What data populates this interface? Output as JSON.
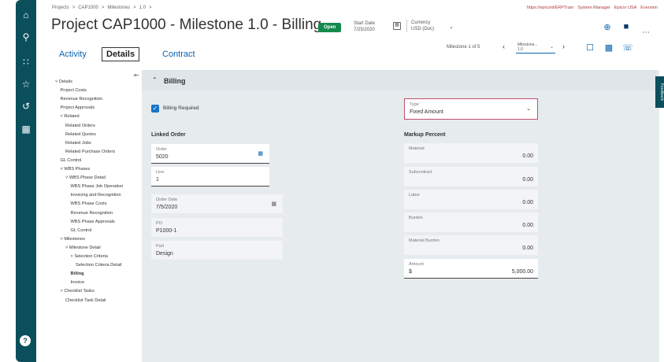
{
  "breadcrumb": [
    "Projects",
    ">",
    "CAP1000",
    ">",
    "Milestones",
    ">",
    "1.0",
    ">"
  ],
  "top_links": [
    "https://epicorti/ERPTrain",
    "System Manager",
    "Epicor USA",
    "Everston"
  ],
  "title": "Project CAP1000 - Milestone 1.0 - Billing",
  "status_badge": "Open",
  "start_date": {
    "label": "Start Date",
    "value": "7/25/2020"
  },
  "currency": {
    "label": "Currency",
    "value": "USD (Doc)"
  },
  "tabs": [
    {
      "label": "Activity"
    },
    {
      "label": "Details"
    },
    {
      "label": "Contract"
    }
  ],
  "milestone_nav": {
    "label": "Milestone 1 of 5",
    "select_label": "Milestone...",
    "select_value": "1.0"
  },
  "tree": [
    {
      "label": "˅ Details",
      "indent": 0,
      "bold": false
    },
    {
      "label": "Project Costs",
      "indent": 1,
      "bold": false
    },
    {
      "label": "Revenue Recognition",
      "indent": 1,
      "bold": false
    },
    {
      "label": "Project Approvals",
      "indent": 1,
      "bold": false
    },
    {
      "label": "˅ Related",
      "indent": 1,
      "bold": false
    },
    {
      "label": "Related Orders",
      "indent": 2,
      "bold": false
    },
    {
      "label": "Related Quotes",
      "indent": 2,
      "bold": false
    },
    {
      "label": "Related Jobs",
      "indent": 2,
      "bold": false
    },
    {
      "label": "Related Purchase Orders",
      "indent": 2,
      "bold": false
    },
    {
      "label": "GL Control",
      "indent": 1,
      "bold": false
    },
    {
      "label": "˅ WBS Phases",
      "indent": 1,
      "bold": false
    },
    {
      "label": "˅ WBS Phase Detail",
      "indent": 2,
      "bold": false
    },
    {
      "label": "WBS Phase Job Operation",
      "indent": 3,
      "bold": false
    },
    {
      "label": "Invoicing and Recognition",
      "indent": 3,
      "bold": false
    },
    {
      "label": "WBS Phase Costs",
      "indent": 3,
      "bold": false
    },
    {
      "label": "Revenue Recognition",
      "indent": 3,
      "bold": false
    },
    {
      "label": "WBS Phase Approvals",
      "indent": 3,
      "bold": false
    },
    {
      "label": "GL Control",
      "indent": 3,
      "bold": false
    },
    {
      "label": "˅ Milestones",
      "indent": 1,
      "bold": false
    },
    {
      "label": "˅ Milestone Detail",
      "indent": 2,
      "bold": false
    },
    {
      "label": "˅ Selection Criteria",
      "indent": 3,
      "bold": false
    },
    {
      "label": "Selection Criteria Detail",
      "indent": 4,
      "bold": false
    },
    {
      "label": "Billing",
      "indent": 3,
      "bold": true
    },
    {
      "label": "Invoice",
      "indent": 3,
      "bold": false
    },
    {
      "label": "˅ Checklist Tasks",
      "indent": 1,
      "bold": false
    },
    {
      "label": "Checklist Task Detail",
      "indent": 2,
      "bold": false
    }
  ],
  "section": {
    "title": "Billing"
  },
  "billing_required": {
    "label": "Billing Required",
    "checked": true
  },
  "type_field": {
    "label": "Type",
    "value": "Fixed Amount"
  },
  "linked_order": {
    "title": "Linked Order",
    "order": {
      "label": "Order",
      "value": "5020"
    },
    "line": {
      "label": "Line",
      "value": "1"
    },
    "order_date": {
      "label": "Order Date",
      "value": "7/5/2020"
    },
    "po": {
      "label": "PO",
      "value": "P1000-1"
    },
    "part": {
      "label": "Part",
      "value": "Design"
    }
  },
  "markup": {
    "title": "Markup Percent",
    "material": {
      "label": "Material",
      "value": "0.00"
    },
    "subcontract": {
      "label": "Subcontract",
      "value": "0.00"
    },
    "labor": {
      "label": "Labor",
      "value": "0.00"
    },
    "burden": {
      "label": "Burden",
      "value": "0.00"
    },
    "material_burden": {
      "label": "Material Burden",
      "value": "0.00"
    },
    "amount": {
      "label": "Amount",
      "currency": "$",
      "value": "5,000.00"
    }
  },
  "feedback_label": "Feedback",
  "colors": {
    "rail": "#0b4f5c",
    "accent": "#0b63b0",
    "badge": "#168a4d",
    "panel": "#e6ebed"
  }
}
